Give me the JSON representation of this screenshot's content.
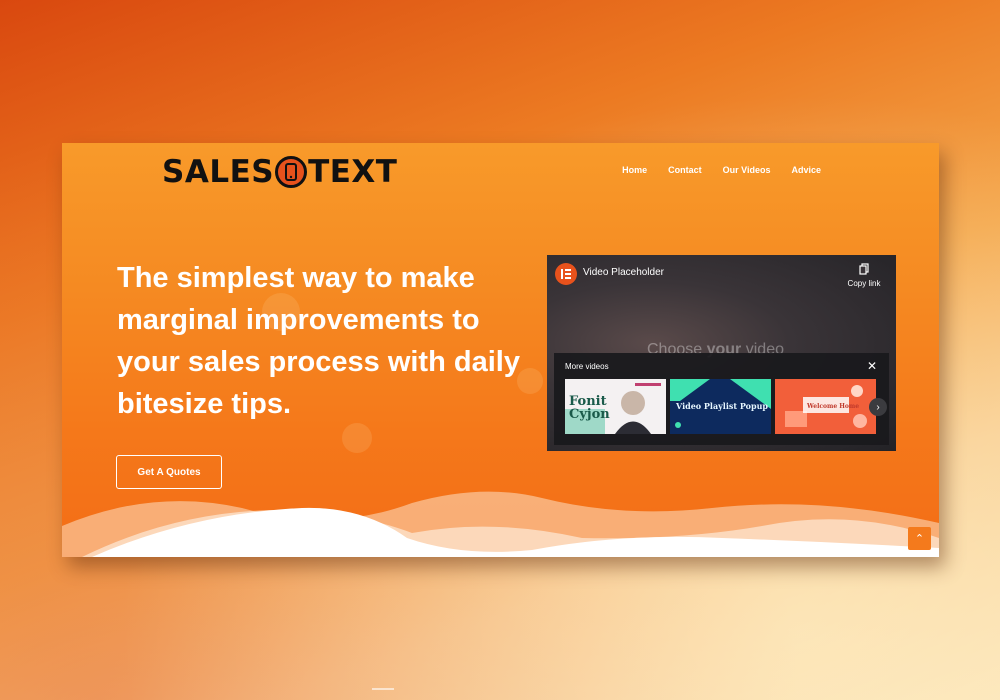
{
  "brand": {
    "logo_left": "SALES",
    "logo_right": "TEXT"
  },
  "nav": {
    "items": [
      {
        "label": "Home"
      },
      {
        "label": "Contact"
      },
      {
        "label": "Our Videos"
      },
      {
        "label": "Advice"
      }
    ]
  },
  "hero": {
    "headline": "The simplest way to make marginal improvements to your sales process with daily bitesize tips.",
    "cta_label": "Get A Quotes"
  },
  "video": {
    "title": "Video Placeholder",
    "copy_link_label": "Copy link",
    "background_text_1": "Choose",
    "background_text_2": "your",
    "background_text_3": "video",
    "more_videos_label": "More videos",
    "close_symbol": "✕",
    "thumbnails": [
      {
        "label": "Fonit Cyjon"
      },
      {
        "label": "Video Playlist Popup"
      },
      {
        "label": "Welcome Home"
      }
    ],
    "next_symbol": "›"
  },
  "scroll_top_symbol": "⌃",
  "colors": {
    "accent": "#e8521c",
    "hero_orange": "#f58a22",
    "text_white": "#ffffff"
  }
}
